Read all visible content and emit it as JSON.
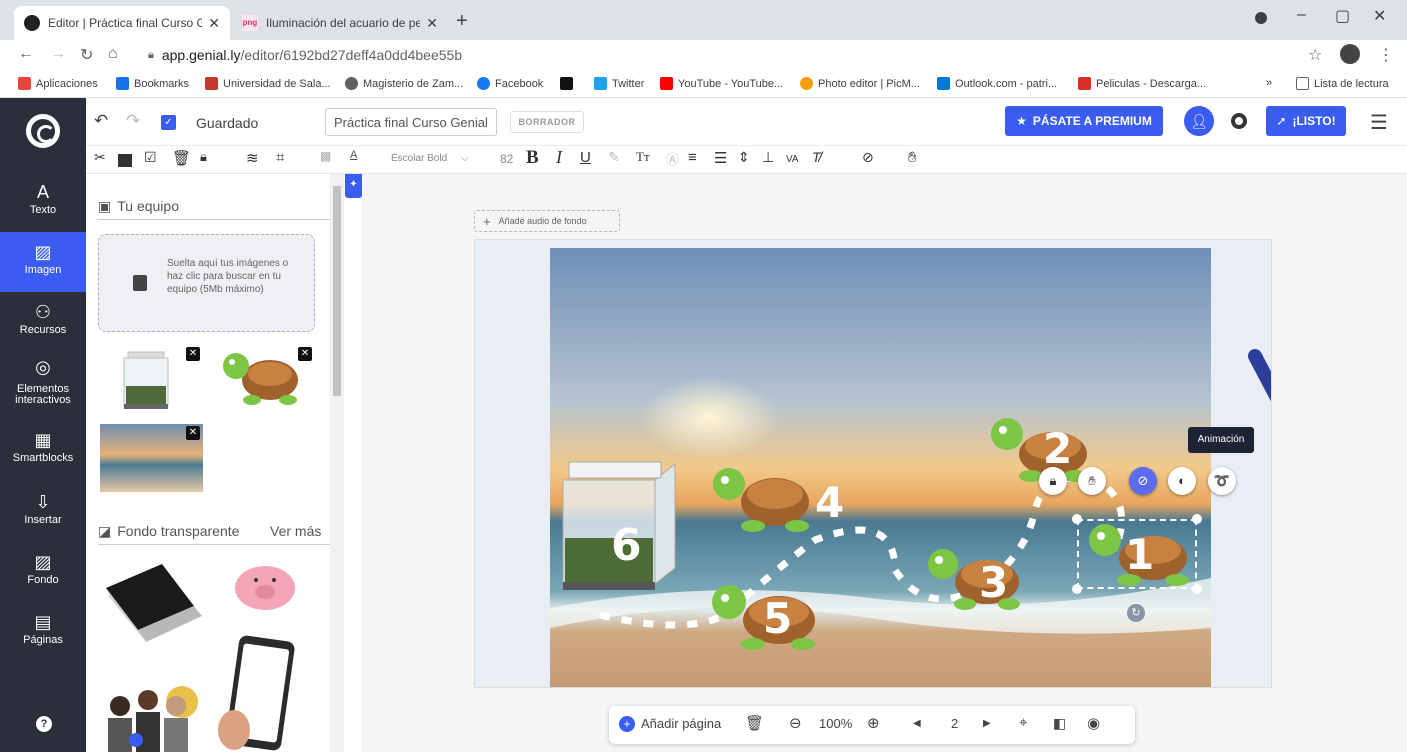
{
  "browser": {
    "tabs": [
      {
        "title": "Editor | Práctica final Curso Genia"
      },
      {
        "title": "Iluminación del acuario de peces"
      }
    ],
    "url_host": "app.genial.ly",
    "url_path": "/editor/6192bd27deff4a0dd4bee55b",
    "bookmarks": [
      {
        "label": "Aplicaciones",
        "color": "#e8453c"
      },
      {
        "label": "Bookmarks",
        "color": "#1a73e8"
      },
      {
        "label": "Universidad de Sala...",
        "color": "#c0392b"
      },
      {
        "label": "Magisterio de Zam...",
        "color": "#5f6368"
      },
      {
        "label": "Facebook",
        "color": "#1877f2"
      },
      {
        "label": "",
        "color": "#111111"
      },
      {
        "label": "Twitter",
        "color": "#1da1f2"
      },
      {
        "label": "YouTube - YouTube...",
        "color": "#ff0000"
      },
      {
        "label": "Photo editor | PicM...",
        "color": "#f59e0b"
      },
      {
        "label": "Outlook.com - patri...",
        "color": "#0078d4"
      },
      {
        "label": "Peliculas - Descarga...",
        "color": "#d93025"
      }
    ],
    "reading_list": "Lista de lectura",
    "bookmarks_overflow": "»"
  },
  "editor": {
    "saved_label": "Guardado",
    "title_value": "Práctica final Curso Genial",
    "draft_badge": "BORRADOR",
    "premium_label": "PÁSATE A PREMIUM",
    "done_label": "¡LISTO!",
    "font_name": "Escolar Bold",
    "font_size": "82",
    "add_audio": "Añade audio de fondo",
    "tooltip": "Animación"
  },
  "rail": {
    "items": [
      {
        "label": "Texto",
        "icon": "A"
      },
      {
        "label": "Imagen",
        "icon": "▨"
      },
      {
        "label": "Recursos",
        "icon": "⚇"
      },
      {
        "label": "Elementos interactivos",
        "icon": "◎"
      },
      {
        "label": "Smartblocks",
        "icon": "▦"
      },
      {
        "label": "Insertar",
        "icon": "⇩"
      },
      {
        "label": "Fondo",
        "icon": "▨"
      },
      {
        "label": "Páginas",
        "icon": "▤"
      }
    ],
    "help": "?"
  },
  "panel": {
    "section1": "Tu equipo",
    "dropzone_text": "Suelta aquí tus imágenes o haz clic para buscar en tu equipo (5Mb máximo)",
    "section2": "Fondo transparente",
    "section2_more": "Ver más"
  },
  "slide_numbers": [
    "6",
    "5",
    "4",
    "3",
    "2",
    "1"
  ],
  "bottom_bar": {
    "add_page": "Añadir página",
    "zoom": "100%",
    "page": "2"
  },
  "colors": {
    "accent": "#3b5cf0",
    "rail": "#2a2f3a"
  }
}
